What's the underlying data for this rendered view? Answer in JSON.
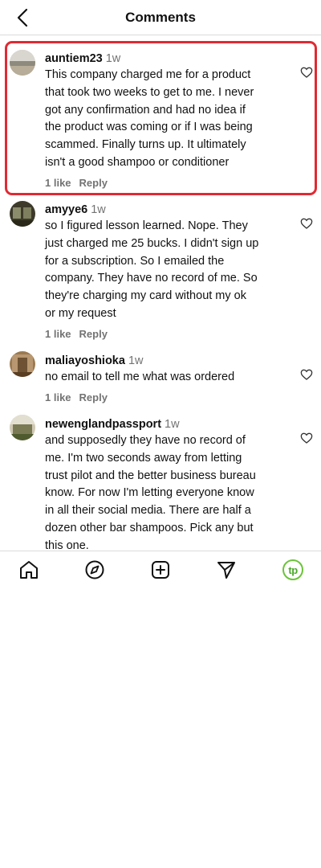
{
  "header": {
    "title": "Comments"
  },
  "comments": [
    {
      "username": "auntiem23",
      "time": "1w",
      "lines": [
        "This company charged me for a product",
        "that took two weeks to get to me. I never",
        "got any confirmation and had no idea if",
        "the product was coming or if I was being",
        "scammed. Finally turns up. It ultimately",
        "isn't a good shampoo or conditioner"
      ],
      "likes": "1 like",
      "reply": "Reply"
    },
    {
      "username": "amyye6",
      "time": "1w",
      "lines": [
        "so I figured lesson learned. Nope. They",
        "just charged me 25 bucks. I didn't sign up",
        "for a subscription. So I emailed the",
        "company. They have no record of me. So",
        "they're charging my card without my ok",
        "or my request"
      ],
      "likes": "1 like",
      "reply": "Reply"
    },
    {
      "username": "maliayoshioka",
      "time": "1w",
      "lines": [
        "no email to tell me what was ordered"
      ],
      "likes": "1 like",
      "reply": "Reply"
    },
    {
      "username": "newenglandpassport",
      "time": "1w",
      "lines": [
        "and supposedly they have no record of",
        "me. I'm two seconds away from letting",
        "trust pilot and the better business bureau",
        "know. For now I'm letting everyone know",
        "in all their social media. There are half a",
        "dozen other bar shampoos. Pick any but",
        "this one."
      ]
    }
  ],
  "tabbar": {
    "profile_badge": "tp"
  },
  "colors": {
    "highlight": "#e02a33",
    "badge": "#6cc33b",
    "secondary_text": "#737373"
  }
}
